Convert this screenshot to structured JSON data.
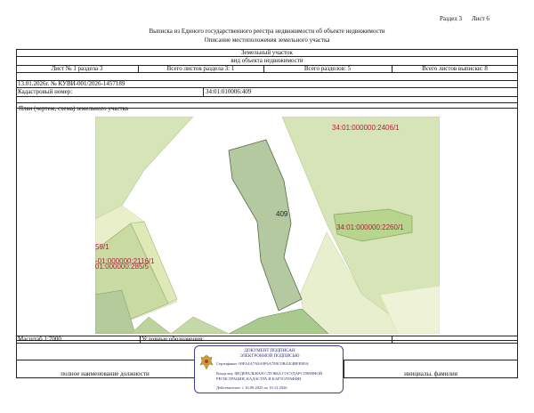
{
  "header": {
    "section": "Раздел 3",
    "sheet": "Лист 6",
    "title": "Выписка из Единого государственного реестра недвижимости об объекте недвижимости",
    "subtitle": "Описание местоположения земельного участка"
  },
  "table": {
    "object_type": "Земельный участок",
    "object_kind": "вид объекта недвижимости",
    "sheet_of_section": "Лист № 1 раздела 3",
    "sheets_in_section": "Всего листов раздела 3: 1",
    "total_sections": "Всего разделов: 5",
    "total_sheets": "Всего листов выписки: 8",
    "date_number": "13.01.2026г. № КУВИ-001/2026-1457189",
    "cadastral_label": "Кадастровый номер:",
    "cadastral_value": "34:01:010006:409",
    "plan_label": "План (чертеж, схема) земельного участка",
    "scale": "Масштаб 1:7000",
    "legend_label": "Условные обозначения:",
    "position_label": "полное наименование должности",
    "initials_label": "инициалы, фамилия"
  },
  "map": {
    "labels": {
      "parcel_2406": "34:01:000000:2406/1",
      "parcel_409": "409",
      "parcel_2260": "34:01:000000:2260/1",
      "parcel_59": "59/1",
      "parcel_2116": "-01:000000:2116/1",
      "parcel_285": "01:000000:285/5"
    }
  },
  "stamp": {
    "title1": "ДОКУМЕНТ ПОДПИСАН",
    "title2": "ЭЛЕКТРОННОЙ ПОДПИСЬЮ",
    "cert": "Сертификат: 00FA4A7A8A9F6A7E8C0B41E4BFEB9A",
    "owner1": "Владелец: ФЕДЕРАЛЬНАЯ СЛУЖБА ГОСУДАРСТВЕННОЙ",
    "owner2": "РЕГИСТРАЦИИ, КАДАСТРА И КАРТОГРАФИИ",
    "valid": "Действителен: с 16.09.2025 по 10.12.2026"
  }
}
